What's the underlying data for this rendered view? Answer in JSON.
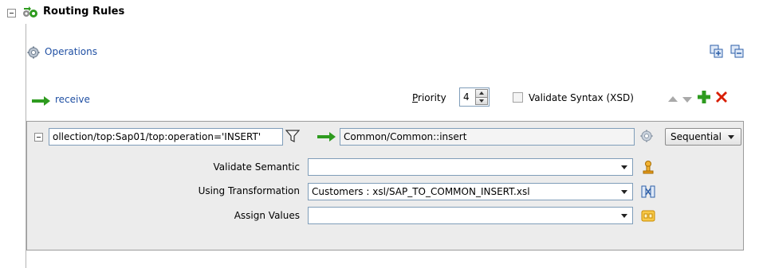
{
  "header": {
    "title": "Routing Rules",
    "icon": "routing-rules-icon"
  },
  "operations": {
    "label": "Operations",
    "icon": "gear-icon"
  },
  "toolbar_top": {
    "expand_icon": "expand-all-icon",
    "collapse_icon": "collapse-all-icon"
  },
  "operation": {
    "name": "receive",
    "icon": "arrow-right-icon"
  },
  "priority": {
    "label_accel": "P",
    "label_rest": "riority",
    "value": "4"
  },
  "validate_syntax": {
    "label": "Validate Syntax (XSD)",
    "checked": false
  },
  "rule": {
    "filter_expression": "ollection/top:Sap01/top:operation='INSERT'",
    "target_service": "Common/Common::insert",
    "routing_mode": "Sequential",
    "validate_semantic": {
      "label": "Validate Semantic",
      "value": ""
    },
    "using_transformation": {
      "label": "Using Transformation",
      "value": "Customers : xsl/SAP_TO_COMMON_INSERT.xsl"
    },
    "assign_values": {
      "label": "Assign Values",
      "value": ""
    }
  },
  "colors": {
    "link": "#1f4fa3",
    "add_green": "#2e9b1f",
    "delete_red": "#d81e05",
    "panel_bg": "#ececec"
  }
}
